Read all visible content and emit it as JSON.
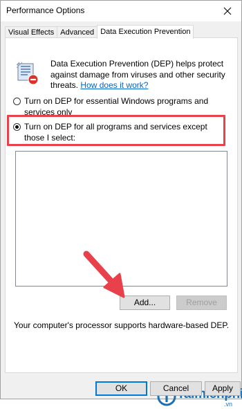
{
  "window": {
    "title": "Performance Options",
    "close_icon": "close-icon"
  },
  "tabs": [
    {
      "label": "Visual Effects",
      "active": false
    },
    {
      "label": "Advanced",
      "active": false
    },
    {
      "label": "Data Execution Prevention",
      "active": true
    }
  ],
  "dep": {
    "icon": "dep-shield-icon",
    "description": "Data Execution Prevention (DEP) helps protect against damage from viruses and other security threats.",
    "link_text": "How does it work?"
  },
  "options": {
    "essential_label": "Turn on DEP for essential Windows programs and services only",
    "all_label": "Turn on DEP for all programs and services except those I select:",
    "selected": "all"
  },
  "exceptions": {
    "items": []
  },
  "buttons": {
    "add": "Add...",
    "remove": "Remove",
    "ok": "OK",
    "cancel": "Cancel",
    "apply": "Apply"
  },
  "support_text": "Your computer's processor supports hardware-based DEP.",
  "watermark": {
    "brand": "Taimienphi",
    "suffix": ".vn"
  },
  "colors": {
    "highlight": "#e8414b",
    "arrow": "#e8414b",
    "link": "#0066cc",
    "brand": "#1a6fb5"
  }
}
